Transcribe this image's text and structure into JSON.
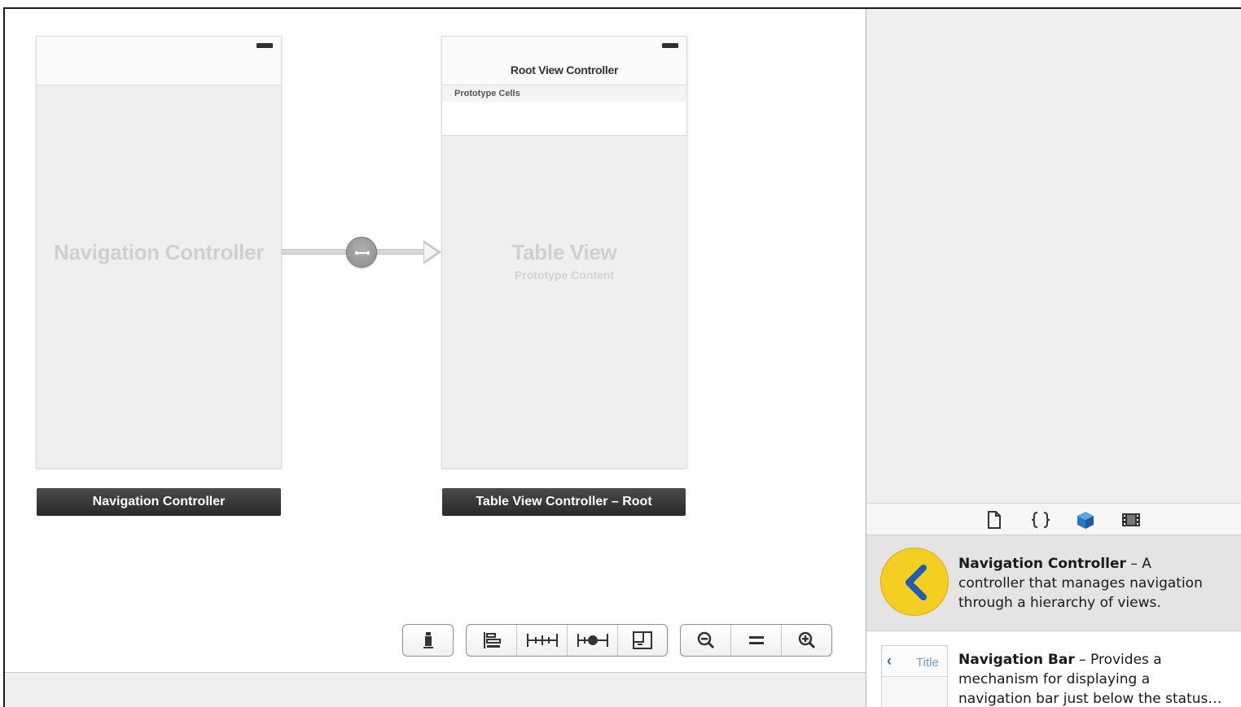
{
  "canvas": {
    "nav_scene": {
      "label": "Navigation Controller",
      "caption": "Navigation Controller"
    },
    "table_scene": {
      "nav_title": "Root View Controller",
      "prototype_header": "Prototype Cells",
      "label": "Table View",
      "sublabel": "Prototype Content",
      "caption": "Table View Controller – Root"
    },
    "segue": {
      "icon": "segue-link-icon"
    },
    "toolbar": {
      "groups": [
        [
          "simulated-metrics-icon"
        ],
        [
          "align-icon",
          "pin-icon",
          "resolve-issues-icon",
          "resize-icon"
        ],
        [
          "zoom-out-icon",
          "zoom-actual-icon",
          "zoom-in-icon"
        ]
      ]
    }
  },
  "library": {
    "tabs": [
      "file-template-icon",
      "code-snippet-icon",
      "object-library-icon",
      "media-library-icon"
    ],
    "selected_tab": "object-library-icon",
    "accent_color": "#2b78c6",
    "items": [
      {
        "name": "Navigation Controller",
        "separator": " – ",
        "description_line1": "A",
        "description_line2": "controller that manages navigation",
        "description_line3": "through a hierarchy of views.",
        "icon": "navigation-controller-icon",
        "icon_color": "#f4cf22"
      },
      {
        "name": "Navigation Bar",
        "separator": " – ",
        "description_line1": "Provides a",
        "description_line2": "mechanism for displaying a",
        "description_line3": "navigation bar just below the status…",
        "icon": "navigation-bar-icon",
        "icon_text": "Title"
      }
    ]
  }
}
